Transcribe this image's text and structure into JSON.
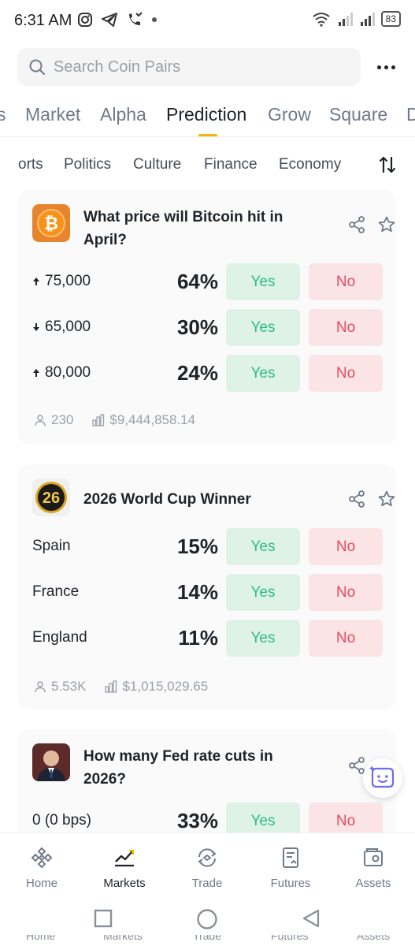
{
  "status_bar": {
    "time": "6:31 AM",
    "battery": "83"
  },
  "search": {
    "placeholder": "Search Coin Pairs"
  },
  "main_tabs": [
    {
      "label": "s"
    },
    {
      "label": "Market"
    },
    {
      "label": "Alpha"
    },
    {
      "label": "Prediction",
      "active": true
    },
    {
      "label": "Grow"
    },
    {
      "label": "Square"
    },
    {
      "label": "D"
    }
  ],
  "sub_tabs": [
    "orts",
    "Politics",
    "Culture",
    "Finance",
    "Economy"
  ],
  "cards": [
    {
      "title": "What price will Bitcoin hit in April?",
      "icon": "bitcoin-icon",
      "outcomes": [
        {
          "label": "75,000",
          "arrow": "up",
          "pct": "64%",
          "yes": "Yes",
          "no": "No"
        },
        {
          "label": "65,000",
          "arrow": "down",
          "pct": "30%",
          "yes": "Yes",
          "no": "No"
        },
        {
          "label": "80,000",
          "arrow": "up",
          "pct": "24%",
          "yes": "Yes",
          "no": "No"
        }
      ],
      "participants": "230",
      "volume": "$9,444,858.14"
    },
    {
      "title": "2026 World Cup Winner",
      "icon": "world-cup-26-icon",
      "icon_text": "26",
      "outcomes": [
        {
          "label": "Spain",
          "pct": "15%",
          "yes": "Yes",
          "no": "No"
        },
        {
          "label": "France",
          "pct": "14%",
          "yes": "Yes",
          "no": "No"
        },
        {
          "label": "England",
          "pct": "11%",
          "yes": "Yes",
          "no": "No"
        }
      ],
      "participants": "5.53K",
      "volume": "$1,015,029.65"
    },
    {
      "title": "How many Fed rate cuts in 2026?",
      "icon": "fed-chair-portrait-icon",
      "outcomes": [
        {
          "label": "0 (0 bps)",
          "pct": "33%",
          "yes": "Yes",
          "no": "No"
        }
      ]
    }
  ],
  "bottom_nav": [
    {
      "label": "Home",
      "icon": "home-icon"
    },
    {
      "label": "Markets",
      "icon": "markets-chart-icon",
      "active": true
    },
    {
      "label": "Trade",
      "icon": "trade-icon"
    },
    {
      "label": "Futures",
      "icon": "futures-icon"
    },
    {
      "label": "Assets",
      "icon": "assets-wallet-icon"
    }
  ],
  "ghost_labels": [
    "Home",
    "Markets",
    "Trade",
    "Futures",
    "Assets"
  ],
  "colors": {
    "accent": "#f0b90b",
    "yes_bg": "#def2e6",
    "yes_text": "#2ebd85",
    "no_bg": "#fae4e6",
    "no_text": "#e74c5e",
    "card_bg": "#fafafa"
  }
}
